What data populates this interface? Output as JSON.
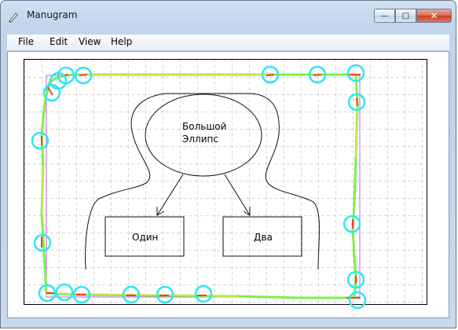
{
  "window": {
    "title": "Manugram",
    "buttons": {
      "minimize": "—",
      "maximize": "□",
      "close": "✕"
    }
  },
  "menu": {
    "file": "File",
    "edit": "Edit",
    "view": "View",
    "help": "Help"
  },
  "canvas": {
    "ellipse_label_line1": "Большой",
    "ellipse_label_line2": "Эллипс",
    "box_left_label": "Один",
    "box_right_label": "Два"
  },
  "colors": {
    "marker": "#2fe6f0",
    "stroke_green": "#7cf14a",
    "stroke_red": "#ff3b2f",
    "guide": "#c060e0",
    "grid": "#b0b0b0"
  }
}
